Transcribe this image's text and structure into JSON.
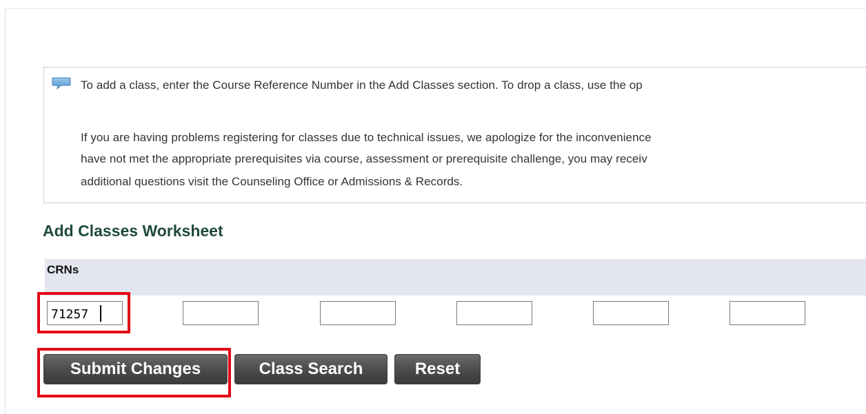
{
  "info": {
    "icon": "speech-bubble-icon",
    "line1": "To add a class, enter the Course Reference Number in the Add Classes section. To drop a class, use the op",
    "line2": "If you are having problems registering for classes due to technical issues, we apologize for the inconvenience",
    "line3": "have not met the appropriate prerequisites via course, assessment or prerequisite challenge, you may receiv",
    "line4": "additional questions visit the Counseling Office or Admissions & Records."
  },
  "worksheet": {
    "title": "Add Classes Worksheet",
    "column_header": "CRNs",
    "crns": [
      "71257",
      "",
      "",
      "",
      "",
      ""
    ]
  },
  "buttons": {
    "submit": "Submit Changes",
    "class_search": "Class Search",
    "reset": "Reset"
  },
  "colors": {
    "highlight": "#e30613",
    "title": "#1f4b3b",
    "header_band": "#e3e6ee"
  }
}
